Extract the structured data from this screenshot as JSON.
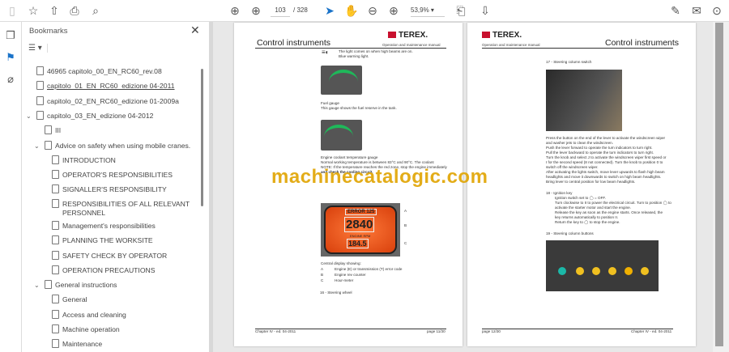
{
  "toolbar": {
    "current_page": "103",
    "total_pages": "/ 328",
    "zoom": "53,9%"
  },
  "bookmarks": {
    "title": "Bookmarks",
    "items": [
      {
        "label": "46965 capitolo_00_EN_RC60_rev.08"
      },
      {
        "label": "capitolo_01_EN_RC60_edizione 04-2011"
      },
      {
        "label": "capitolo_02_EN_RC60_edizione 01-2009a"
      },
      {
        "label": "capitolo_03_EN_edizione 04-2012"
      },
      {
        "label": "III"
      },
      {
        "label": "Advice on safety when using mobile cranes."
      },
      {
        "label": "INTRODUCTION"
      },
      {
        "label": "OPERATOR'S RESPONSIBILITIES"
      },
      {
        "label": "SIGNALLER'S RESPONSIBILITY"
      },
      {
        "label": "RESPONSIBILITIES OF ALL RELEVANT"
      },
      {
        "label": "PERSONNEL"
      },
      {
        "label": "Management's responsibilities"
      },
      {
        "label": "PLANNING THE WORKSITE"
      },
      {
        "label": "SAFETY CHECK BY OPERATOR"
      },
      {
        "label": "OPERATION PRECAUTIONS"
      },
      {
        "label": "General instructions"
      },
      {
        "label": "General"
      },
      {
        "label": "Access and cleaning"
      },
      {
        "label": "Machine operation"
      },
      {
        "label": "Maintenance"
      }
    ]
  },
  "left_page": {
    "title": "Control instruments",
    "brand": "TEREX.",
    "subtitle": "Operation and maintenance manual",
    "light_text": [
      "The light comes on when high beams are on.",
      "Blue warning light."
    ],
    "fuel_title": "Fuel gauge",
    "fuel_text": "This gauge shows the fuel reserve in the tank.",
    "coolant_title": "Engine coolant temperature gauge",
    "coolant_text": "Normal working temperature is between 83°C and 90°C. The coolant",
    "coolant_text2": "NOTE: If the temperature reaches the red zone, stop the engine immediately",
    "coolant_text3": "and check the cooling circuit.",
    "display": {
      "error": "ERROR 125",
      "rpm": "2840",
      "rpm_label": "ENGINE RPM",
      "hours": "184.5"
    },
    "callouts": [
      "A",
      "B",
      "C"
    ],
    "display_caption": "Central display showing:",
    "legend": [
      {
        "k": "A",
        "v": "Engine (E) or transmission (T) error code"
      },
      {
        "k": "B",
        "v": "Engine rev counter"
      },
      {
        "k": "C",
        "v": "Hour-meter"
      }
    ],
    "item16": "16 -  Steering wheel",
    "footer_left": "Chapter IV - ed. 04-2011",
    "footer_right": "page 11/30"
  },
  "right_page": {
    "title": "Control instruments",
    "brand": "TEREX.",
    "subtitle": "Operation and maintenance manual",
    "item17": "17 -  Steering column switch",
    "p17": [
      "Press the button on the end of the lever to activate the windscreen wiper",
      "and washer jets to clean the windscreen.",
      "Push the lever forward to operate the turn indicators to turn right.",
      "Pull the lever backward to operate the turn indicators to turn right.",
      "Turn the knob and select J to activate the windscreen wiper first speed or",
      "I for the second speed (8 not connected). Turn the knob to position 0 to",
      "switch off the windscreen wiper.",
      "After activating the lights switch, move lever upwards to flash high beam",
      "headlights and move it downwards to switch on high beam headlights.",
      "Bring lever to central position for low beam headlights."
    ],
    "item18": "18 -  Ignition key",
    "p18": [
      "Ignition switch set to  ◯  = OFF.",
      "Turn clockwise to II to power the electrical circuit. Turn to position ◯ to",
      "activate the starter motor and start the engine.",
      "Release the key as soon as the engine starts. Once released, the",
      "key returns automatically to position II.",
      "Return the key to ◯ to stop the engine."
    ],
    "item19": "19 -  Steering column buttons",
    "footer_left": "page 12/30",
    "footer_right": "Chapter IV - ed. 04-2011"
  },
  "watermark": "machinecatalogic.com"
}
